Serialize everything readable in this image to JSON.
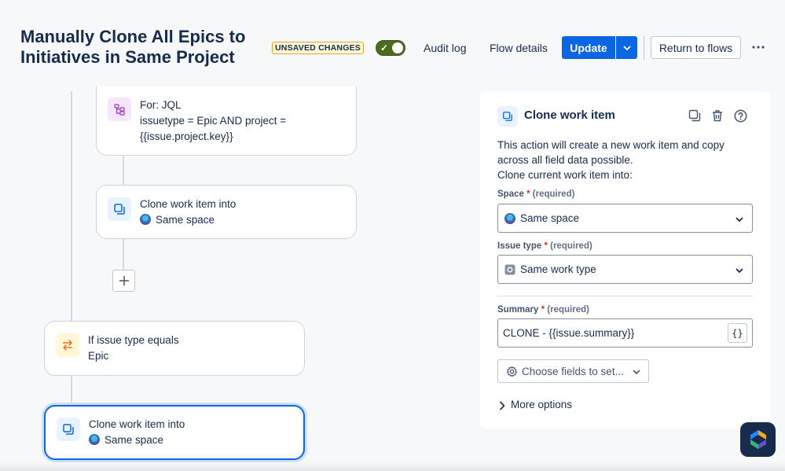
{
  "header": {
    "title": "Manually Clone All Epics to Initiatives in Same Project",
    "unsaved_badge": "UNSAVED CHANGES",
    "toggle_enabled": true,
    "audit_log": "Audit log",
    "flow_details": "Flow details",
    "update": "Update",
    "return_to_flows": "Return to flows",
    "more_icon": "more-horizontal-icon"
  },
  "flow": {
    "for_jql": {
      "title": "For: JQL",
      "query": "issuetype = Epic AND project = {{issue.project.key}}"
    },
    "clone_1": {
      "title": "Clone work item into",
      "target": "Same space"
    },
    "condition": {
      "title": "If issue type equals",
      "value": "Epic"
    },
    "clone_2": {
      "title": "Clone work item into",
      "target": "Same space"
    }
  },
  "panel": {
    "title": "Clone work item",
    "description_1": "This action will create a new work item and copy across all field data possible.",
    "description_2": "Clone current work item into:",
    "space": {
      "label": "Space",
      "required": "(required)",
      "value": "Same space"
    },
    "issue_type": {
      "label": "Issue type",
      "required": "(required)",
      "value": "Same work type"
    },
    "summary": {
      "label": "Summary",
      "required": "(required)",
      "value": "CLONE - {{issue.summary}}",
      "brace": "{}"
    },
    "choose_fields": "Choose fields to set...",
    "more_options": "More options"
  },
  "colors": {
    "primary": "#0c66e4",
    "toggle_on": "#4c6b1f",
    "selected_outline": "#0c66e4",
    "required": "#c9372c"
  }
}
